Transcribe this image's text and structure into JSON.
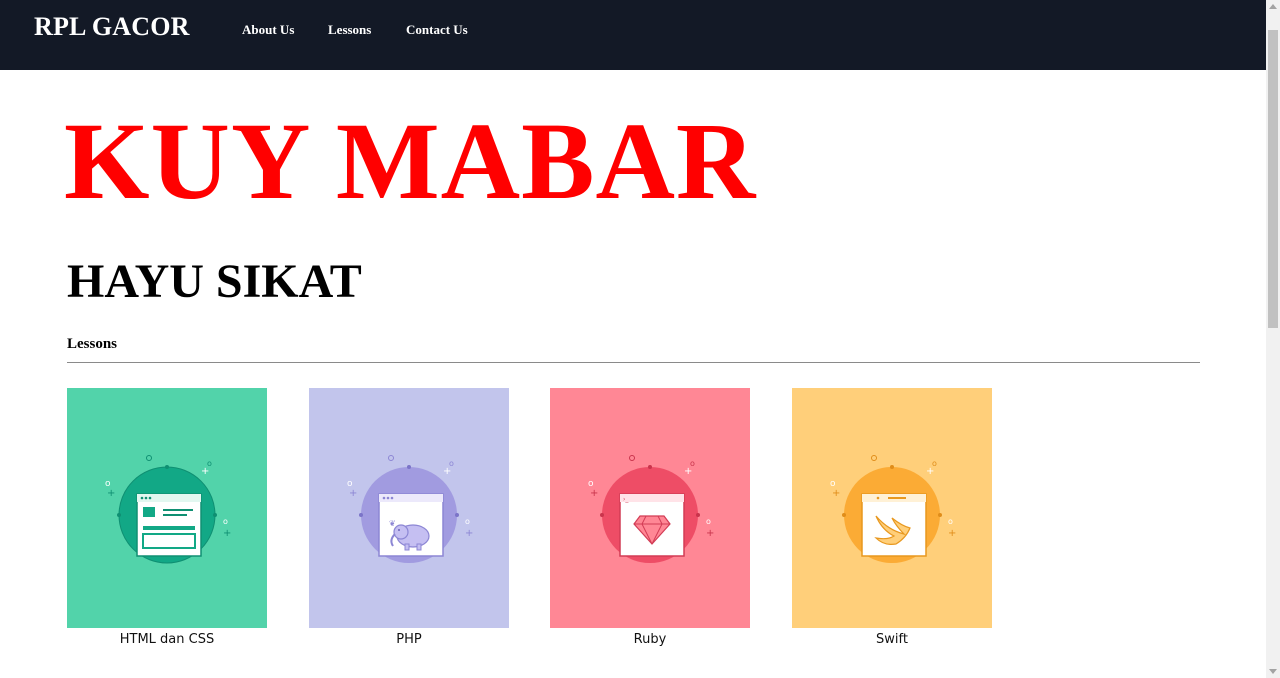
{
  "navbar": {
    "brand": "RPL GACOR",
    "links": [
      "About Us",
      "Lessons",
      "Contact Us"
    ],
    "background": "#131926"
  },
  "hero": {
    "title": "KUY MABAR",
    "title_color": "#ff0000",
    "subtitle": "HAYU SIKAT"
  },
  "lessons": {
    "section_title": "Lessons",
    "cards": [
      {
        "label": "HTML dan CSS",
        "icon": "html-css-browser-icon",
        "color": "#52d3aa"
      },
      {
        "label": "PHP",
        "icon": "php-elephant-icon",
        "color": "#c2c5ec"
      },
      {
        "label": "Ruby",
        "icon": "ruby-gem-icon",
        "color": "#ff8795"
      },
      {
        "label": "Swift",
        "icon": "swift-bird-icon",
        "color": "#ffcf7a"
      }
    ]
  }
}
